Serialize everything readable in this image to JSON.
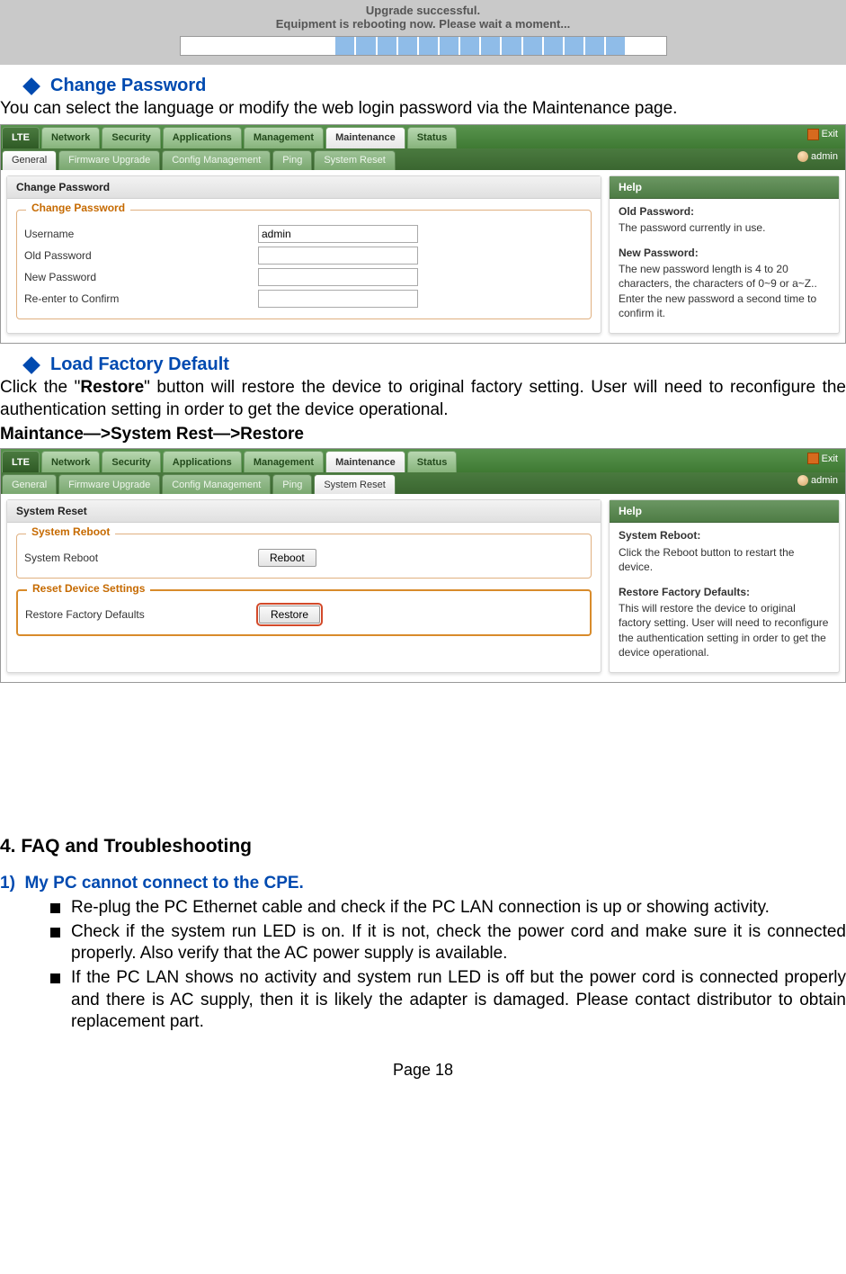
{
  "upgrade": {
    "line1": "Upgrade successful.",
    "line2": "Equipment is rebooting now. Please wait a moment..."
  },
  "sections": {
    "change_password": {
      "heading": "Change Password",
      "text": "You can select the language or modify the web login password via the Maintenance page."
    },
    "load_factory": {
      "heading": "Load Factory Default",
      "text_pre": "Click the \"",
      "text_bold": "Restore",
      "text_post": "\" button will restore the device to original factory setting. User will need to reconfigure the authentication setting in order to get the device operational.",
      "path": "Maintance—>System Rest—>Restore"
    }
  },
  "ui_common": {
    "tabs1": [
      "LTE",
      "Network",
      "Security",
      "Applications",
      "Management",
      "Maintenance",
      "Status"
    ],
    "exit": "Exit",
    "admin": "admin",
    "help_title": "Help"
  },
  "ui1": {
    "tabs2": [
      "General",
      "Firmware Upgrade",
      "Config Management",
      "Ping",
      "System Reset"
    ],
    "active_tab2": "General",
    "panel_title": "Change Password",
    "group_legend": "Change Password",
    "fields": {
      "username_label": "Username",
      "username_value": "admin",
      "oldpw_label": "Old Password",
      "newpw_label": "New Password",
      "confirm_label": "Re-enter to Confirm"
    },
    "help": {
      "h1_title": "Old Password:",
      "h1_text": "The password currently in use.",
      "h2_title": "New Password:",
      "h2_text": "The new password length is 4 to 20 characters, the characters of 0~9 or a~Z.. Enter the new password a second time to confirm it."
    }
  },
  "ui2": {
    "tabs2": [
      "General",
      "Firmware Upgrade",
      "Config Management",
      "Ping",
      "System Reset"
    ],
    "active_tab2": "System Reset",
    "panel_title": "System Reset",
    "group1_legend": "System Reboot",
    "reboot_label": "System Reboot",
    "reboot_btn": "Reboot",
    "group2_legend": "Reset Device Settings",
    "restore_label": "Restore Factory Defaults",
    "restore_btn": "Restore",
    "help": {
      "h1_title": "System Reboot:",
      "h1_text": "Click the Reboot button to restart the device.",
      "h2_title": "Restore Factory Defaults:",
      "h2_text": "This will restore the device to original factory setting. User will need to reconfigure the authentication setting in order to get the device operational."
    }
  },
  "faq": {
    "heading": "4.  FAQ and Troubleshooting",
    "q1_num": "1)",
    "q1_title": "My PC cannot connect to the CPE.",
    "bullets": [
      "Re-plug the PC Ethernet cable and check if the PC LAN connection is up or showing activity.",
      "Check if the system run LED is on. If it is not, check the power cord and make sure it is connected properly. Also verify that the AC power supply is available.",
      "If the PC LAN shows no activity and system run LED is off but the power cord is connected properly and there is AC supply, then it is likely the adapter is damaged. Please contact distributor to obtain replacement part."
    ]
  },
  "page_num": "Page 18"
}
